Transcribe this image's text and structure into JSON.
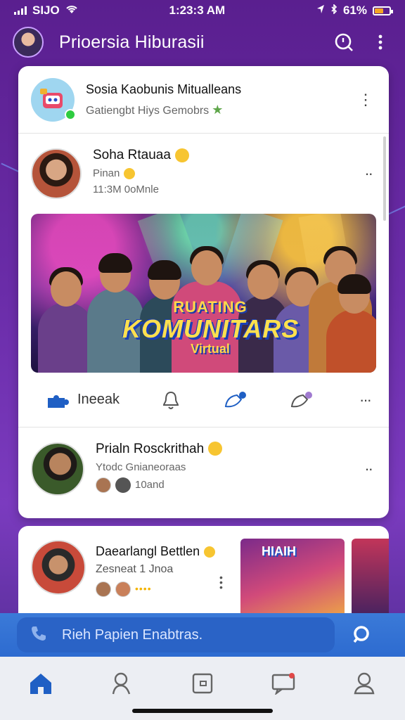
{
  "status_bar": {
    "carrier": "SIJO",
    "time": "1:23:3 AM",
    "battery": "61%",
    "battery_level": 0.6
  },
  "header": {
    "title": "Prioersia Hiburasii",
    "icons": [
      "profile-avatar",
      "search-icon",
      "more-vertical-icon"
    ]
  },
  "group": {
    "name": "Sosia Kaobunis Mitualleans",
    "subtitle": "Gatiengbt Hiys Gemobrs",
    "badge_icon": "star-icon"
  },
  "post1": {
    "author": "Soha Rtauaa",
    "meta_line1": "Pinan",
    "meta_line2": "11:3M 0oMnle",
    "banner": {
      "line1": "RUATING",
      "line2": "KOMUNITARS",
      "line3": "Virtual"
    },
    "actions": [
      {
        "icon": "puzzle-icon",
        "label": "Ineeak"
      },
      {
        "icon": "bell-icon",
        "label": ""
      },
      {
        "icon": "comment-icon",
        "label": ""
      },
      {
        "icon": "share-icon",
        "label": ""
      }
    ],
    "accent": "#1f5fc4"
  },
  "post2": {
    "author": "Prialn Rosckrithah",
    "subtitle": "Ytodc Gnianeoraas",
    "meta": "10and"
  },
  "post3": {
    "author": "Daearlangl Bettlen",
    "subtitle": "Zesneat 1 Jnoa",
    "dots": "••••",
    "thumb_text": "HIAIH"
  },
  "search": {
    "placeholder": "Rieh Papien Enabtras."
  },
  "bottom_nav": [
    "home-icon",
    "people-icon",
    "gallery-icon",
    "chat-icon",
    "profile-icon"
  ],
  "colors": {
    "primary": "#2d6bd0",
    "background": "#6a2ca8",
    "card": "#ffffff"
  }
}
